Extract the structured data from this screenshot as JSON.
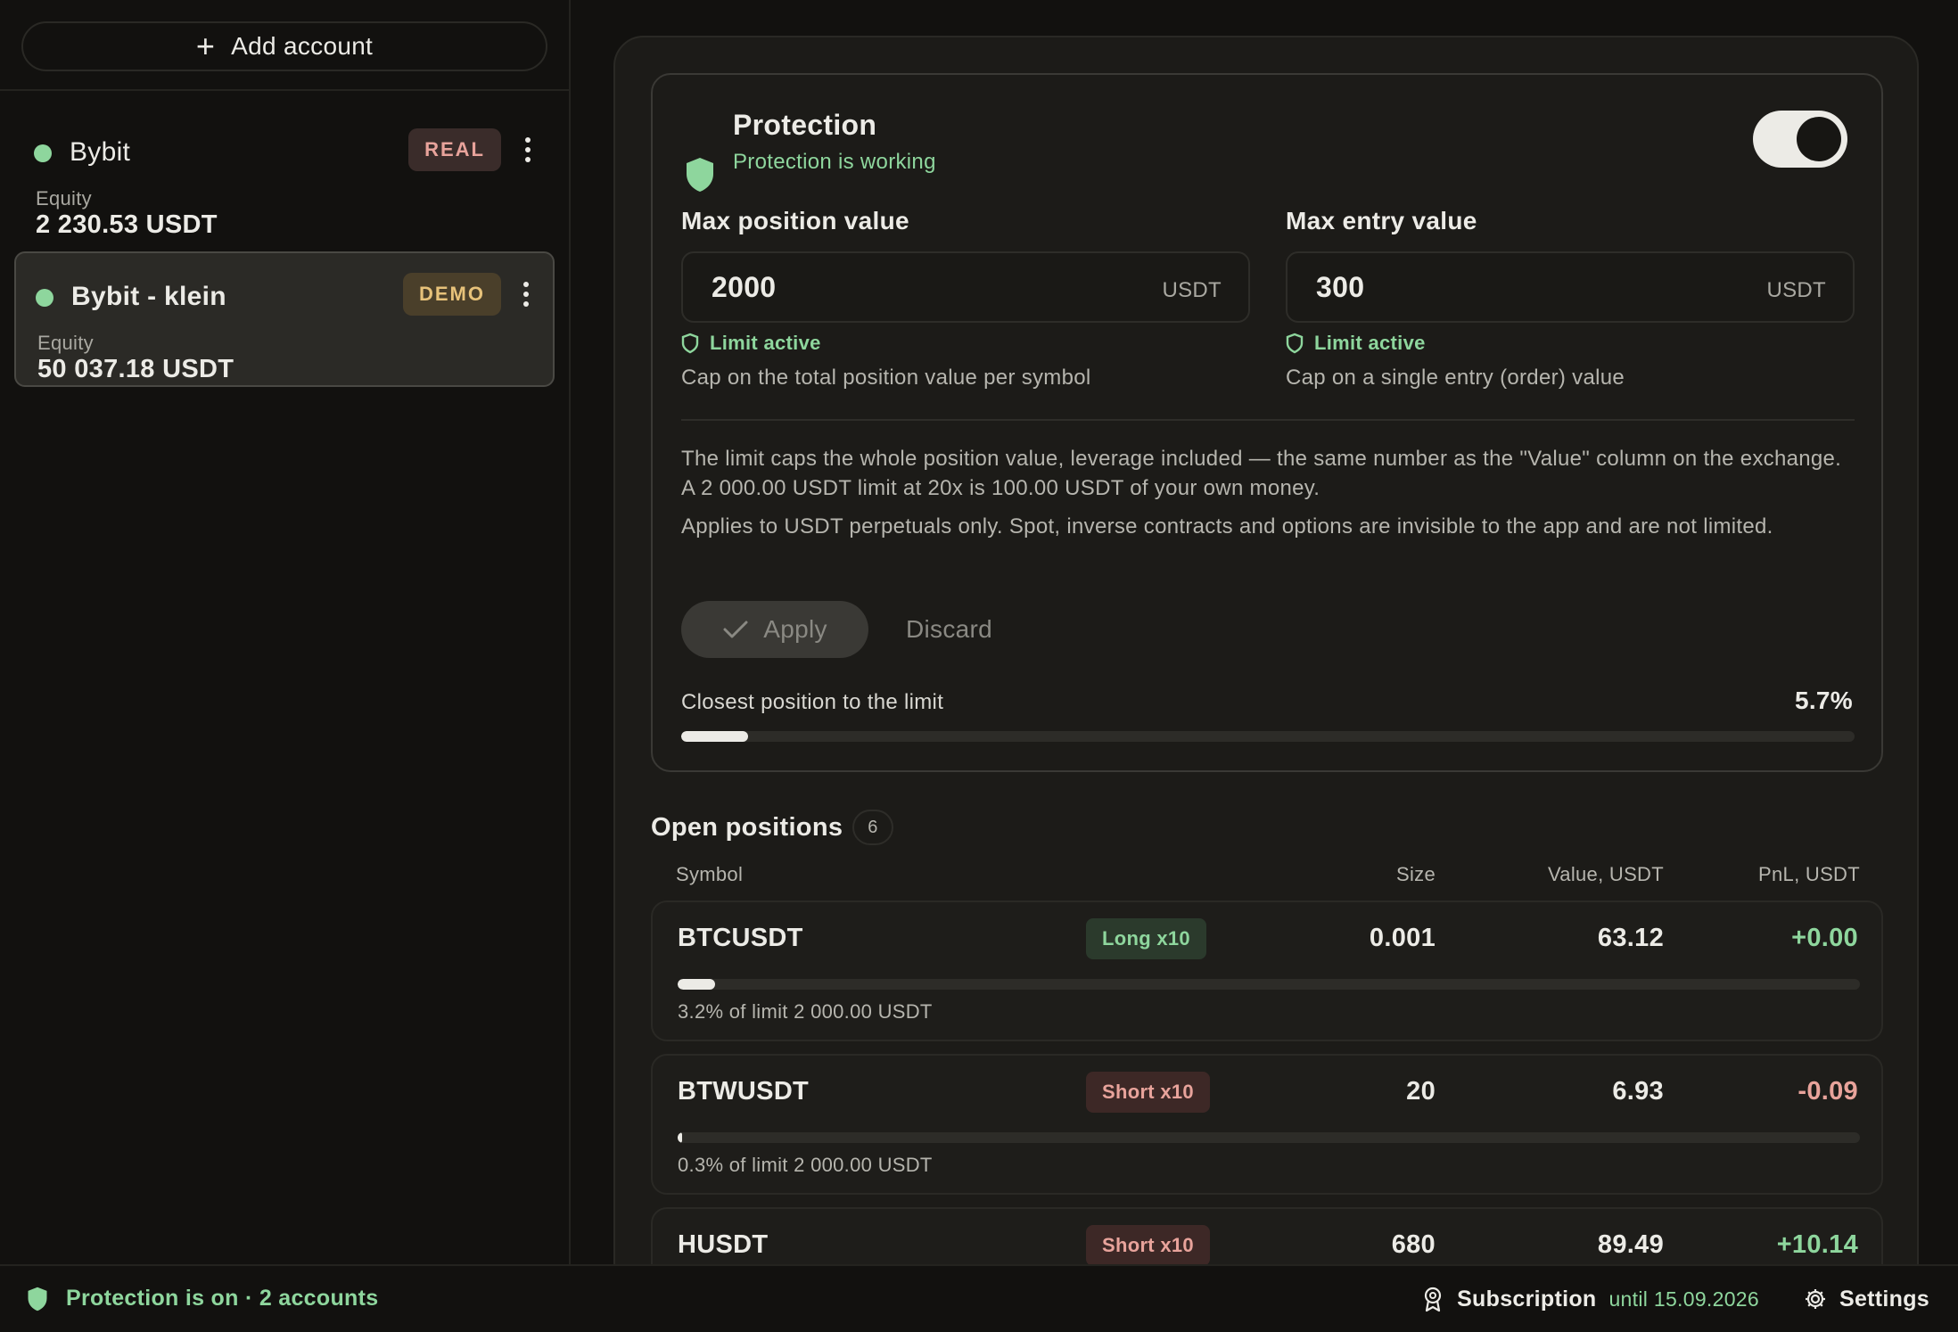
{
  "sidebar": {
    "add_account_label": "Add account",
    "accounts": [
      {
        "name": "Bybit",
        "badge": "REAL",
        "equity_label": "Equity",
        "equity": "2 230.53 USDT"
      },
      {
        "name": "Bybit - klein",
        "badge": "DEMO",
        "equity_label": "Equity",
        "equity": "50 037.18 USDT"
      }
    ]
  },
  "protection": {
    "title": "Protection",
    "status": "Protection is working",
    "enabled": true,
    "max_position": {
      "label": "Max position value",
      "value": "2000",
      "unit": "USDT",
      "limit_status": "Limit active",
      "description": "Cap on the total position value per symbol"
    },
    "max_entry": {
      "label": "Max entry value",
      "value": "300",
      "unit": "USDT",
      "limit_status": "Limit active",
      "description": "Cap on a single entry (order) value"
    },
    "info_1": "The limit caps the whole position value, leverage included — the same number as the \"Value\" column on the exchange. A 2 000.00 USDT limit at 20x is 100.00 USDT of your own money.",
    "info_2": "Applies to USDT perpetuals only. Spot, inverse contracts and options are invisible to the app and are not limited.",
    "apply_label": "Apply",
    "discard_label": "Discard",
    "closest_label": "Closest position to the limit",
    "closest_value": "5.7%",
    "closest_fraction": 0.057
  },
  "positions": {
    "title": "Open positions",
    "count": "6",
    "columns": {
      "symbol": "Symbol",
      "size": "Size",
      "value": "Value, USDT",
      "pnl": "PnL, USDT"
    },
    "rows": [
      {
        "symbol": "BTCUSDT",
        "side": "Long x10",
        "size": "0.001",
        "value": "63.12",
        "pnl": "+0.00",
        "note": "3.2% of limit 2 000.00 USDT",
        "fraction": 0.032
      },
      {
        "symbol": "BTWUSDT",
        "side": "Short x10",
        "size": "20",
        "value": "6.93",
        "pnl": "-0.09",
        "note": "0.3% of limit 2 000.00 USDT",
        "fraction": 0.003
      },
      {
        "symbol": "HUSDT",
        "side": "Short x10",
        "size": "680",
        "value": "89.49",
        "pnl": "+10.14",
        "note": "",
        "fraction": 0
      }
    ]
  },
  "footer": {
    "status": "Protection is on · 2 accounts",
    "subscription_label": "Subscription",
    "subscription_until": "until 15.09.2026",
    "settings_label": "Settings"
  },
  "colors": {
    "accent_green": "#8ed69d",
    "accent_red": "#e8a39b",
    "background": "#12110f"
  }
}
